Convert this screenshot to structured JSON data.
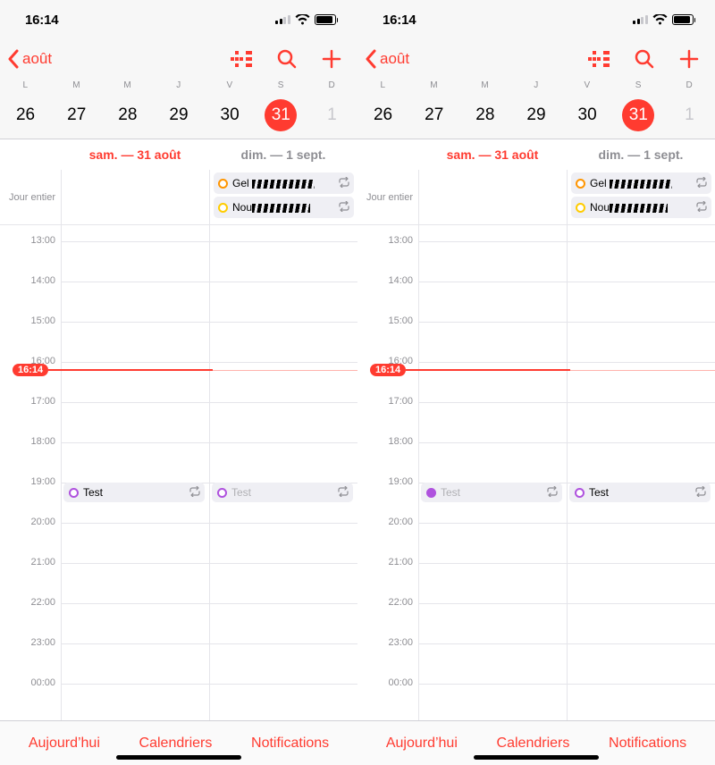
{
  "status": {
    "time": "16:14"
  },
  "nav": {
    "back_label": "août"
  },
  "week": {
    "labels": [
      "L",
      "M",
      "M",
      "J",
      "V",
      "S",
      "D"
    ],
    "dates": [
      "26",
      "27",
      "28",
      "29",
      "30",
      "31",
      "1"
    ],
    "selected_index": 5,
    "dim_index": 6
  },
  "days": {
    "left_title": "sam. — 31 août",
    "right_title": "dim. — 1 sept."
  },
  "allday": {
    "label": "Jour entier",
    "events": [
      {
        "label": "Gel",
        "color": "#ff9500"
      },
      {
        "label": "Nou",
        "color": "#ffcc00"
      }
    ]
  },
  "hours": [
    "13:00",
    "14:00",
    "15:00",
    "16:00",
    "17:00",
    "18:00",
    "19:00",
    "20:00",
    "21:00",
    "22:00",
    "23:00",
    "00:00"
  ],
  "now": {
    "label": "16:14",
    "hour_index": 3,
    "fraction": 0.23
  },
  "timed_events": {
    "test_label": "Test",
    "hour_index": 6,
    "fraction": 0.25
  },
  "toolbar": {
    "today": "Aujourd’hui",
    "calendars": "Calendriers",
    "inbox": "Notifications"
  },
  "screens": [
    {
      "sat_active": true
    },
    {
      "sat_active": false
    }
  ]
}
